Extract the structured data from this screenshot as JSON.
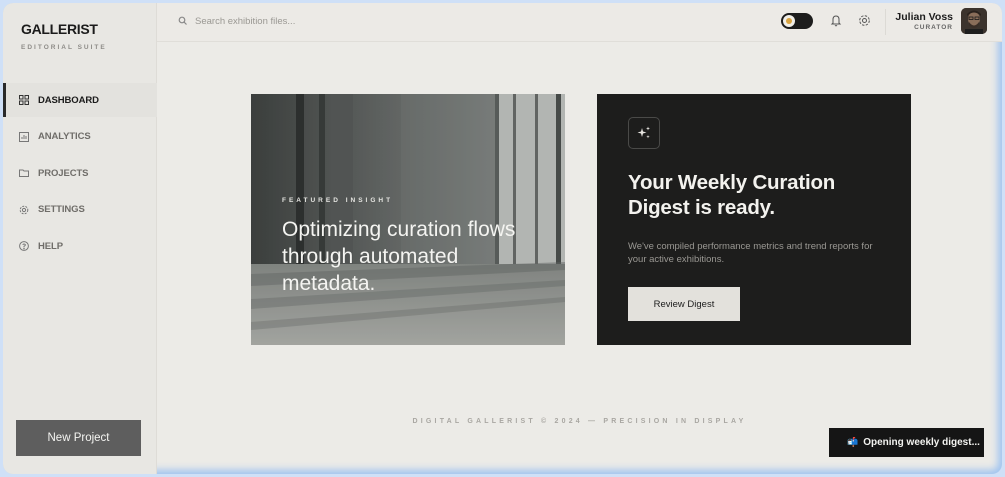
{
  "brand": {
    "title": "GALLERIST",
    "subtitle": "EDITORIAL SUITE"
  },
  "sidebar": {
    "items": [
      {
        "label": "DASHBOARD",
        "icon": "grid-icon",
        "active": true
      },
      {
        "label": "ANALYTICS",
        "icon": "chart-icon",
        "active": false
      },
      {
        "label": "PROJECTS",
        "icon": "folder-icon",
        "active": false
      },
      {
        "label": "SETTINGS",
        "icon": "gear-icon",
        "active": false
      },
      {
        "label": "HELP",
        "icon": "help-icon",
        "active": false
      }
    ],
    "new_project_label": "New Project"
  },
  "topbar": {
    "search_placeholder": "Search exhibition files...",
    "user_name": "Julian Voss",
    "user_role": "CURATOR"
  },
  "featured": {
    "eyebrow": "FEATURED INSIGHT",
    "title": "Optimizing curation flows through automated metadata."
  },
  "digest": {
    "title": "Your Weekly Curation Digest is ready.",
    "body": "We've compiled performance metrics and trend reports for your active exhibitions.",
    "button_label": "Review Digest"
  },
  "footer": {
    "text": "DIGITAL GALLERIST © 2024 — PRECISION IN DISPLAY"
  },
  "toast": {
    "text": "Opening weekly digest...",
    "icon": "📬"
  },
  "colors": {
    "accent_dark": "#1d1d1c",
    "toggle_dot": "#d9a441",
    "page_bg": "#ecebe7"
  }
}
